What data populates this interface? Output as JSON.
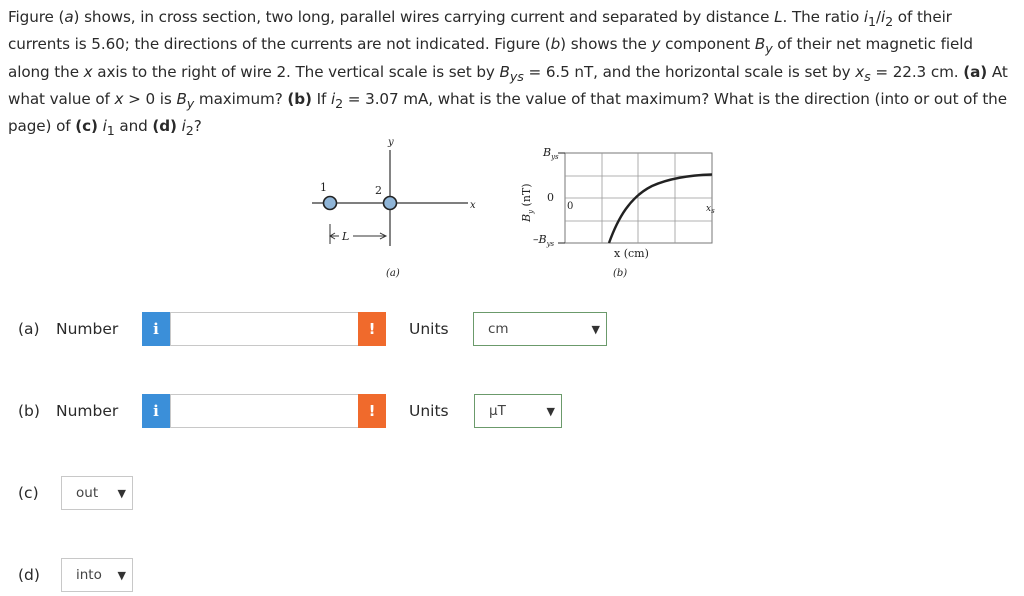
{
  "question": {
    "p1": "Figure (",
    "p1_it": "a",
    "p2": ") shows, in cross section, two long, parallel wires carrying current and separated by distance ",
    "p2_L": "L",
    "p3": ". The ratio ",
    "p3_i1": "i",
    "p3_sub1": "1",
    "p3_slash": "/",
    "p3_i2": "i",
    "p3_sub2": "2",
    "p4": " of their currents is 5.60; the directions of the currents are not indicated. Figure (",
    "p4_it": "b",
    "p5": ") shows the ",
    "p5_y": "y",
    "p6": " component ",
    "p6_B": "B",
    "p6_sub": "y",
    "p7": " of their net magnetic field along the ",
    "p7_x": "x",
    "p8": " axis to the right of wire 2. The vertical scale is set by ",
    "p8_B": "B",
    "p8_sub": "ys",
    "p9": " = 6.5 nT, and the horizontal scale is set by ",
    "p9_x": "x",
    "p9_sub": "s",
    "p10": " = 22.3 cm. ",
    "p10_a": "(a)",
    "p11": " At what value of ",
    "p11_x": "x",
    "p12": " > 0 is ",
    "p12_B": "B",
    "p12_sub": "y",
    "p13": " maximum? ",
    "p13_b": "(b)",
    "p14": " If ",
    "p14_i": "i",
    "p14_sub": "2",
    "p15": " = 3.07 mA, what is the value of that maximum? What is the direction (into or out of the page) of ",
    "p15_c": "(c)",
    "p16": " ",
    "p16_i": "i",
    "p16_sub": "1",
    "p17": " and ",
    "p17_d": "(d)",
    "p18": " ",
    "p18_i": "i",
    "p18_sub": "2",
    "p19": "?"
  },
  "figure_a": {
    "y_axis": "y",
    "x_axis": "x",
    "wire1": "1",
    "wire2": "2",
    "distance": "L",
    "caption": "(a)"
  },
  "figure_b": {
    "y_top": "B",
    "y_top_sub": "ys",
    "zero_y": "0",
    "y_bottom": "–B",
    "y_bottom_sub": "ys",
    "ylabel": "B",
    "ylabel_sub": "y",
    "ylabel_unit": " (nT)",
    "zero_x": "0",
    "xs": "x",
    "xs_sub": "s",
    "xlabel": "x (cm)",
    "caption": "(b)"
  },
  "parts": {
    "a": {
      "label": "(a)",
      "number_label": "Number",
      "info": "i",
      "value": "",
      "warn": "!",
      "units_label": "Units",
      "unit_selected": "cm"
    },
    "b": {
      "label": "(b)",
      "number_label": "Number",
      "info": "i",
      "value": "",
      "warn": "!",
      "units_label": "Units",
      "unit_selected": "μT"
    },
    "c": {
      "label": "(c)",
      "selected": "out"
    },
    "d": {
      "label": "(d)",
      "selected": "into"
    }
  },
  "colors": {
    "info_button": "#3b8fd9",
    "warn_button": "#f06a2c",
    "wire_fill": "#8fb4d6"
  },
  "icons": {
    "info": "info-icon",
    "warn": "exclamation-icon",
    "dropdown": "chevron-down-icon"
  }
}
